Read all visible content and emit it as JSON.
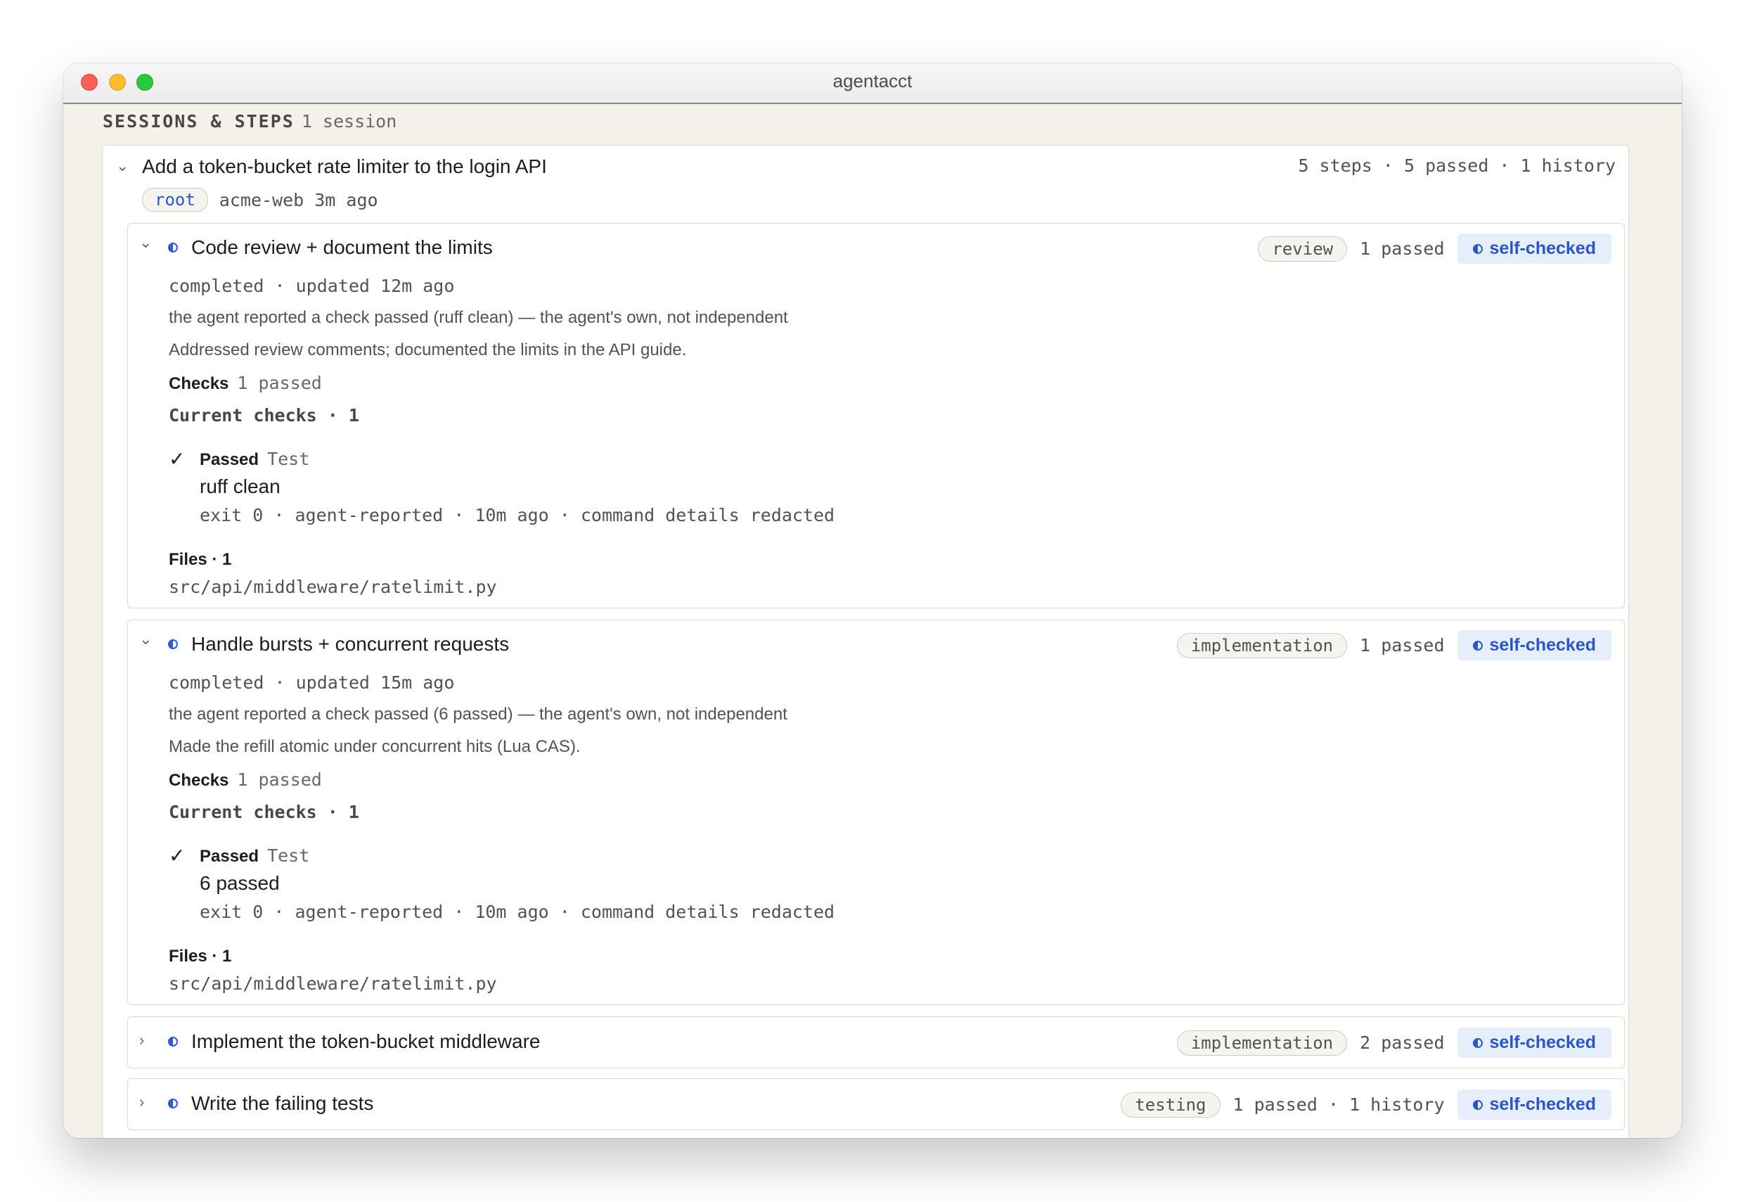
{
  "window": {
    "title": "agentacct"
  },
  "section": {
    "label": "SESSIONS & STEPS",
    "count": "1 session"
  },
  "session": {
    "title": "Add a token-bucket rate limiter to the login API",
    "summary": "5 steps · 5 passed · 1 history",
    "badge": "root",
    "project": "acme-web 3m ago"
  },
  "steps": [
    {
      "title": "Code review + document the limits",
      "kind": "review",
      "count": "1 passed",
      "verification": "self-checked",
      "status": "completed · updated 12m ago",
      "note": "the agent reported a check passed (ruff clean) — the agent's own, not independent",
      "summary": "Addressed review comments; documented the limits in the API guide.",
      "checks_label": "Checks",
      "checks_value": "1 passed",
      "current_checks": "Current checks · 1",
      "check": {
        "mark": "✓",
        "state": "Passed",
        "type": "Test",
        "name": "ruff clean",
        "meta": "exit 0 · agent-reported · 10m ago · command details redacted"
      },
      "files_label": "Files · 1",
      "file": "src/api/middleware/ratelimit.py"
    },
    {
      "title": "Handle bursts + concurrent requests",
      "kind": "implementation",
      "count": "1 passed",
      "verification": "self-checked",
      "status": "completed · updated 15m ago",
      "note": "the agent reported a check passed (6 passed) — the agent's own, not independent",
      "summary": "Made the refill atomic under concurrent hits (Lua CAS).",
      "checks_label": "Checks",
      "checks_value": "1 passed",
      "current_checks": "Current checks · 1",
      "check": {
        "mark": "✓",
        "state": "Passed",
        "type": "Test",
        "name": "6 passed",
        "meta": "exit 0 · agent-reported · 10m ago · command details redacted"
      },
      "files_label": "Files · 1",
      "file": "src/api/middleware/ratelimit.py"
    },
    {
      "title": "Implement the token-bucket middleware",
      "kind": "implementation",
      "count": "2 passed",
      "verification": "self-checked"
    },
    {
      "title": "Write the failing tests",
      "kind": "testing",
      "count": "1 passed · 1 history",
      "verification": "self-checked"
    }
  ]
}
